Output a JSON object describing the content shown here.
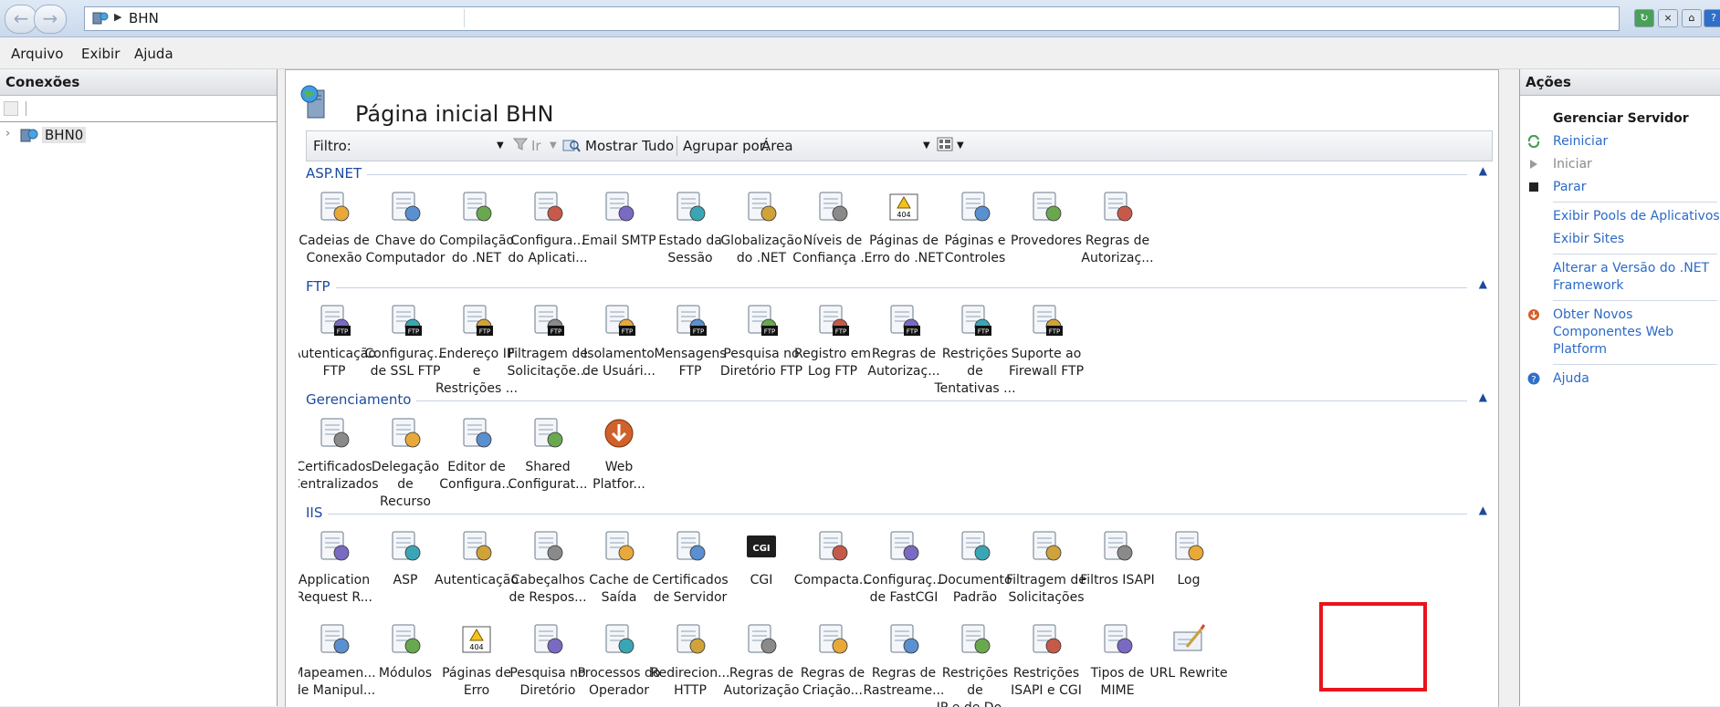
{
  "address_bar": {
    "breadcrumb": "BHN"
  },
  "menu": [
    "Arquivo",
    "Exibir",
    "Ajuda"
  ],
  "connections": {
    "title": "Conexões",
    "tree": [
      {
        "label": "BHN0"
      }
    ]
  },
  "main": {
    "title": "Página inicial BHN",
    "filter_label": "Filtro:",
    "filter_value": "",
    "go_label": "Ir",
    "show_all_label": "Mostrar Tudo",
    "group_by_label": "Agrupar por:",
    "group_by_value": "Área",
    "groups": [
      {
        "name": "ASP.NET",
        "rows": [
          [
            {
              "label": "Cadeias de\nConexão",
              "icon": "connection-strings-icon"
            },
            {
              "label": "Chave do\nComputador",
              "icon": "machine-key-icon"
            },
            {
              "label": "Compilação\ndo .NET",
              "icon": "net-compilation-icon"
            },
            {
              "label": "Configura...\ndo Aplicati...",
              "icon": "app-settings-icon"
            },
            {
              "label": "Email SMTP",
              "icon": "smtp-email-icon"
            },
            {
              "label": "Estado da\nSessão",
              "icon": "session-state-icon"
            },
            {
              "label": "Globalização\ndo .NET",
              "icon": "net-globalization-icon"
            },
            {
              "label": "Níveis de\nConfiança ...",
              "icon": "trust-levels-icon"
            },
            {
              "label": "Páginas de\nErro do .NET",
              "icon": "net-error-pages-icon"
            },
            {
              "label": "Páginas e\nControles",
              "icon": "pages-controls-icon"
            },
            {
              "label": "Provedores",
              "icon": "providers-icon"
            },
            {
              "label": "Regras de\nAutorizaç...",
              "icon": "net-authorization-icon"
            }
          ]
        ]
      },
      {
        "name": "FTP",
        "rows": [
          [
            {
              "label": "Autenticação\nFTP",
              "icon": "ftp-authentication-icon"
            },
            {
              "label": "Configuraç...\nde SSL FTP",
              "icon": "ftp-ssl-icon"
            },
            {
              "label": "Endereço IP e\nRestrições ...",
              "icon": "ftp-ip-restrictions-icon"
            },
            {
              "label": "Filtragem de\nSolicitaçõe...",
              "icon": "ftp-request-filtering-icon"
            },
            {
              "label": "Isolamento\nde Usuári...",
              "icon": "ftp-user-isolation-icon"
            },
            {
              "label": "Mensagens\nFTP",
              "icon": "ftp-messages-icon"
            },
            {
              "label": "Pesquisa no\nDiretório FTP",
              "icon": "ftp-directory-browsing-icon"
            },
            {
              "label": "Registro em\nLog FTP",
              "icon": "ftp-logging-icon"
            },
            {
              "label": "Regras de\nAutorizaç...",
              "icon": "ftp-authorization-icon"
            },
            {
              "label": "Restrições de\nTentativas ...",
              "icon": "ftp-logon-attempts-icon"
            },
            {
              "label": "Suporte ao\nFirewall FTP",
              "icon": "ftp-firewall-icon"
            }
          ]
        ]
      },
      {
        "name": "Gerenciamento",
        "rows": [
          [
            {
              "label": "Certificados\nCentralizados",
              "icon": "centralized-certificates-icon"
            },
            {
              "label": "Delegação de\nRecurso",
              "icon": "feature-delegation-icon"
            },
            {
              "label": "Editor de\nConfigura...",
              "icon": "configuration-editor-icon"
            },
            {
              "label": "Shared\nConfigurat...",
              "icon": "shared-configuration-icon"
            },
            {
              "label": "Web\nPlatfor...",
              "icon": "web-platform-installer-icon"
            }
          ]
        ]
      },
      {
        "name": "IIS",
        "rows": [
          [
            {
              "label": "Application\nRequest R...",
              "icon": "application-request-routing-icon"
            },
            {
              "label": "ASP",
              "icon": "asp-icon"
            },
            {
              "label": "Autenticação",
              "icon": "authentication-icon"
            },
            {
              "label": "Cabeçalhos\nde Respos...",
              "icon": "response-headers-icon"
            },
            {
              "label": "Cache de\nSaída",
              "icon": "output-caching-icon"
            },
            {
              "label": "Certificados\nde Servidor",
              "icon": "server-certificates-icon"
            },
            {
              "label": "CGI",
              "icon": "cgi-icon"
            },
            {
              "label": "Compacta...",
              "icon": "compression-icon"
            },
            {
              "label": "Configuraç...\nde FastCGI",
              "icon": "fastcgi-settings-icon"
            },
            {
              "label": "Documento\nPadrão",
              "icon": "default-document-icon"
            },
            {
              "label": "Filtragem de\nSolicitações",
              "icon": "request-filtering-icon"
            },
            {
              "label": "Filtros ISAPI",
              "icon": "isapi-filters-icon"
            },
            {
              "label": "Log",
              "icon": "logging-icon"
            }
          ],
          [
            {
              "label": "Mapeamen...\nde Manipul...",
              "icon": "handler-mappings-icon"
            },
            {
              "label": "Módulos",
              "icon": "modules-icon"
            },
            {
              "label": "Páginas de\nErro",
              "icon": "error-pages-icon"
            },
            {
              "label": "Pesquisa no\nDiretório",
              "icon": "directory-browsing-icon"
            },
            {
              "label": "Processos do\nOperador",
              "icon": "worker-processes-icon"
            },
            {
              "label": "Redirecion...\nHTTP",
              "icon": "http-redirect-icon"
            },
            {
              "label": "Regras de\nAutorização",
              "icon": "authorization-rules-icon"
            },
            {
              "label": "Regras de\nCriação...",
              "icon": "webdav-authoring-rules-icon"
            },
            {
              "label": "Regras de\nRastreame...",
              "icon": "failed-request-tracing-icon"
            },
            {
              "label": "Restrições de\nIP e de Do...",
              "icon": "ip-domain-restrictions-icon"
            },
            {
              "label": "Restrições\nISAPI e CGI",
              "icon": "isapi-cgi-restrictions-icon"
            },
            {
              "label": "Tipos de\nMIME",
              "icon": "mime-types-icon"
            },
            {
              "label": "URL Rewrite",
              "icon": "url-rewrite-icon"
            }
          ]
        ]
      }
    ]
  },
  "actions": {
    "title": "Ações",
    "items": [
      {
        "type": "title",
        "label": "Gerenciar Servidor"
      },
      {
        "type": "link",
        "label": "Reiniciar",
        "icon": "restart-icon"
      },
      {
        "type": "disabled",
        "label": "Iniciar",
        "icon": "start-icon"
      },
      {
        "type": "link",
        "label": "Parar",
        "icon": "stop-icon"
      },
      {
        "type": "sep"
      },
      {
        "type": "link",
        "label": "Exibir Pools de Aplicativos"
      },
      {
        "type": "link",
        "label": "Exibir Sites"
      },
      {
        "type": "sep"
      },
      {
        "type": "link",
        "label": "Alterar a Versão do .NET Framework"
      },
      {
        "type": "sep"
      },
      {
        "type": "link",
        "label": "Obter Novos Componentes Web Platform",
        "icon": "web-platform-icon"
      },
      {
        "type": "sep"
      },
      {
        "type": "link",
        "label": "Ajuda",
        "icon": "help-icon"
      }
    ]
  },
  "colors": {
    "link": "#2c6ac7",
    "group_header": "#1d4a9e",
    "highlight": "#e8141c"
  }
}
